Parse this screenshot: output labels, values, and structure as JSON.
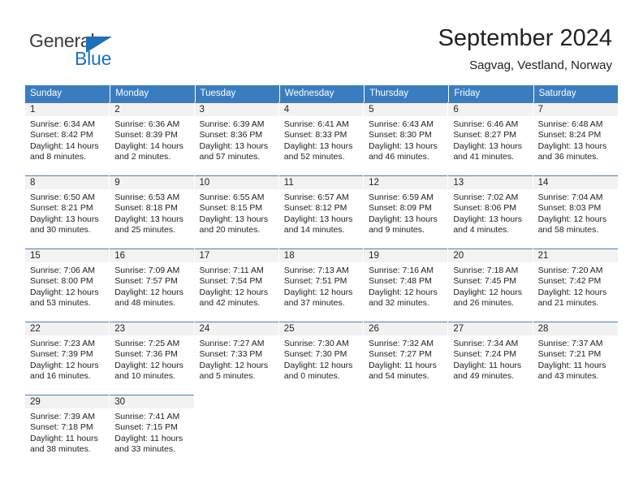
{
  "brand": {
    "line1": "General",
    "line2": "Blue",
    "accent_color": "#1c6fba",
    "triangle_icon": "brand-triangle-icon"
  },
  "header": {
    "title": "September 2024",
    "subtitle": "Sagvag, Vestland, Norway"
  },
  "calendar": {
    "header_bg": "#3a7cc0",
    "daynum_bg": "#f2f2f2",
    "weekdays": [
      "Sunday",
      "Monday",
      "Tuesday",
      "Wednesday",
      "Thursday",
      "Friday",
      "Saturday"
    ],
    "weeks": [
      [
        {
          "day": "1",
          "sunrise": "Sunrise: 6:34 AM",
          "sunset": "Sunset: 8:42 PM",
          "daylight_1": "Daylight: 14 hours",
          "daylight_2": "and 8 minutes."
        },
        {
          "day": "2",
          "sunrise": "Sunrise: 6:36 AM",
          "sunset": "Sunset: 8:39 PM",
          "daylight_1": "Daylight: 14 hours",
          "daylight_2": "and 2 minutes."
        },
        {
          "day": "3",
          "sunrise": "Sunrise: 6:39 AM",
          "sunset": "Sunset: 8:36 PM",
          "daylight_1": "Daylight: 13 hours",
          "daylight_2": "and 57 minutes."
        },
        {
          "day": "4",
          "sunrise": "Sunrise: 6:41 AM",
          "sunset": "Sunset: 8:33 PM",
          "daylight_1": "Daylight: 13 hours",
          "daylight_2": "and 52 minutes."
        },
        {
          "day": "5",
          "sunrise": "Sunrise: 6:43 AM",
          "sunset": "Sunset: 8:30 PM",
          "daylight_1": "Daylight: 13 hours",
          "daylight_2": "and 46 minutes."
        },
        {
          "day": "6",
          "sunrise": "Sunrise: 6:46 AM",
          "sunset": "Sunset: 8:27 PM",
          "daylight_1": "Daylight: 13 hours",
          "daylight_2": "and 41 minutes."
        },
        {
          "day": "7",
          "sunrise": "Sunrise: 6:48 AM",
          "sunset": "Sunset: 8:24 PM",
          "daylight_1": "Daylight: 13 hours",
          "daylight_2": "and 36 minutes."
        }
      ],
      [
        {
          "day": "8",
          "sunrise": "Sunrise: 6:50 AM",
          "sunset": "Sunset: 8:21 PM",
          "daylight_1": "Daylight: 13 hours",
          "daylight_2": "and 30 minutes."
        },
        {
          "day": "9",
          "sunrise": "Sunrise: 6:53 AM",
          "sunset": "Sunset: 8:18 PM",
          "daylight_1": "Daylight: 13 hours",
          "daylight_2": "and 25 minutes."
        },
        {
          "day": "10",
          "sunrise": "Sunrise: 6:55 AM",
          "sunset": "Sunset: 8:15 PM",
          "daylight_1": "Daylight: 13 hours",
          "daylight_2": "and 20 minutes."
        },
        {
          "day": "11",
          "sunrise": "Sunrise: 6:57 AM",
          "sunset": "Sunset: 8:12 PM",
          "daylight_1": "Daylight: 13 hours",
          "daylight_2": "and 14 minutes."
        },
        {
          "day": "12",
          "sunrise": "Sunrise: 6:59 AM",
          "sunset": "Sunset: 8:09 PM",
          "daylight_1": "Daylight: 13 hours",
          "daylight_2": "and 9 minutes."
        },
        {
          "day": "13",
          "sunrise": "Sunrise: 7:02 AM",
          "sunset": "Sunset: 8:06 PM",
          "daylight_1": "Daylight: 13 hours",
          "daylight_2": "and 4 minutes."
        },
        {
          "day": "14",
          "sunrise": "Sunrise: 7:04 AM",
          "sunset": "Sunset: 8:03 PM",
          "daylight_1": "Daylight: 12 hours",
          "daylight_2": "and 58 minutes."
        }
      ],
      [
        {
          "day": "15",
          "sunrise": "Sunrise: 7:06 AM",
          "sunset": "Sunset: 8:00 PM",
          "daylight_1": "Daylight: 12 hours",
          "daylight_2": "and 53 minutes."
        },
        {
          "day": "16",
          "sunrise": "Sunrise: 7:09 AM",
          "sunset": "Sunset: 7:57 PM",
          "daylight_1": "Daylight: 12 hours",
          "daylight_2": "and 48 minutes."
        },
        {
          "day": "17",
          "sunrise": "Sunrise: 7:11 AM",
          "sunset": "Sunset: 7:54 PM",
          "daylight_1": "Daylight: 12 hours",
          "daylight_2": "and 42 minutes."
        },
        {
          "day": "18",
          "sunrise": "Sunrise: 7:13 AM",
          "sunset": "Sunset: 7:51 PM",
          "daylight_1": "Daylight: 12 hours",
          "daylight_2": "and 37 minutes."
        },
        {
          "day": "19",
          "sunrise": "Sunrise: 7:16 AM",
          "sunset": "Sunset: 7:48 PM",
          "daylight_1": "Daylight: 12 hours",
          "daylight_2": "and 32 minutes."
        },
        {
          "day": "20",
          "sunrise": "Sunrise: 7:18 AM",
          "sunset": "Sunset: 7:45 PM",
          "daylight_1": "Daylight: 12 hours",
          "daylight_2": "and 26 minutes."
        },
        {
          "day": "21",
          "sunrise": "Sunrise: 7:20 AM",
          "sunset": "Sunset: 7:42 PM",
          "daylight_1": "Daylight: 12 hours",
          "daylight_2": "and 21 minutes."
        }
      ],
      [
        {
          "day": "22",
          "sunrise": "Sunrise: 7:23 AM",
          "sunset": "Sunset: 7:39 PM",
          "daylight_1": "Daylight: 12 hours",
          "daylight_2": "and 16 minutes."
        },
        {
          "day": "23",
          "sunrise": "Sunrise: 7:25 AM",
          "sunset": "Sunset: 7:36 PM",
          "daylight_1": "Daylight: 12 hours",
          "daylight_2": "and 10 minutes."
        },
        {
          "day": "24",
          "sunrise": "Sunrise: 7:27 AM",
          "sunset": "Sunset: 7:33 PM",
          "daylight_1": "Daylight: 12 hours",
          "daylight_2": "and 5 minutes."
        },
        {
          "day": "25",
          "sunrise": "Sunrise: 7:30 AM",
          "sunset": "Sunset: 7:30 PM",
          "daylight_1": "Daylight: 12 hours",
          "daylight_2": "and 0 minutes."
        },
        {
          "day": "26",
          "sunrise": "Sunrise: 7:32 AM",
          "sunset": "Sunset: 7:27 PM",
          "daylight_1": "Daylight: 11 hours",
          "daylight_2": "and 54 minutes."
        },
        {
          "day": "27",
          "sunrise": "Sunrise: 7:34 AM",
          "sunset": "Sunset: 7:24 PM",
          "daylight_1": "Daylight: 11 hours",
          "daylight_2": "and 49 minutes."
        },
        {
          "day": "28",
          "sunrise": "Sunrise: 7:37 AM",
          "sunset": "Sunset: 7:21 PM",
          "daylight_1": "Daylight: 11 hours",
          "daylight_2": "and 43 minutes."
        }
      ],
      [
        {
          "day": "29",
          "sunrise": "Sunrise: 7:39 AM",
          "sunset": "Sunset: 7:18 PM",
          "daylight_1": "Daylight: 11 hours",
          "daylight_2": "and 38 minutes."
        },
        {
          "day": "30",
          "sunrise": "Sunrise: 7:41 AM",
          "sunset": "Sunset: 7:15 PM",
          "daylight_1": "Daylight: 11 hours",
          "daylight_2": "and 33 minutes."
        },
        {
          "day": "",
          "sunrise": "",
          "sunset": "",
          "daylight_1": "",
          "daylight_2": ""
        },
        {
          "day": "",
          "sunrise": "",
          "sunset": "",
          "daylight_1": "",
          "daylight_2": ""
        },
        {
          "day": "",
          "sunrise": "",
          "sunset": "",
          "daylight_1": "",
          "daylight_2": ""
        },
        {
          "day": "",
          "sunrise": "",
          "sunset": "",
          "daylight_1": "",
          "daylight_2": ""
        },
        {
          "day": "",
          "sunrise": "",
          "sunset": "",
          "daylight_1": "",
          "daylight_2": ""
        }
      ]
    ]
  }
}
